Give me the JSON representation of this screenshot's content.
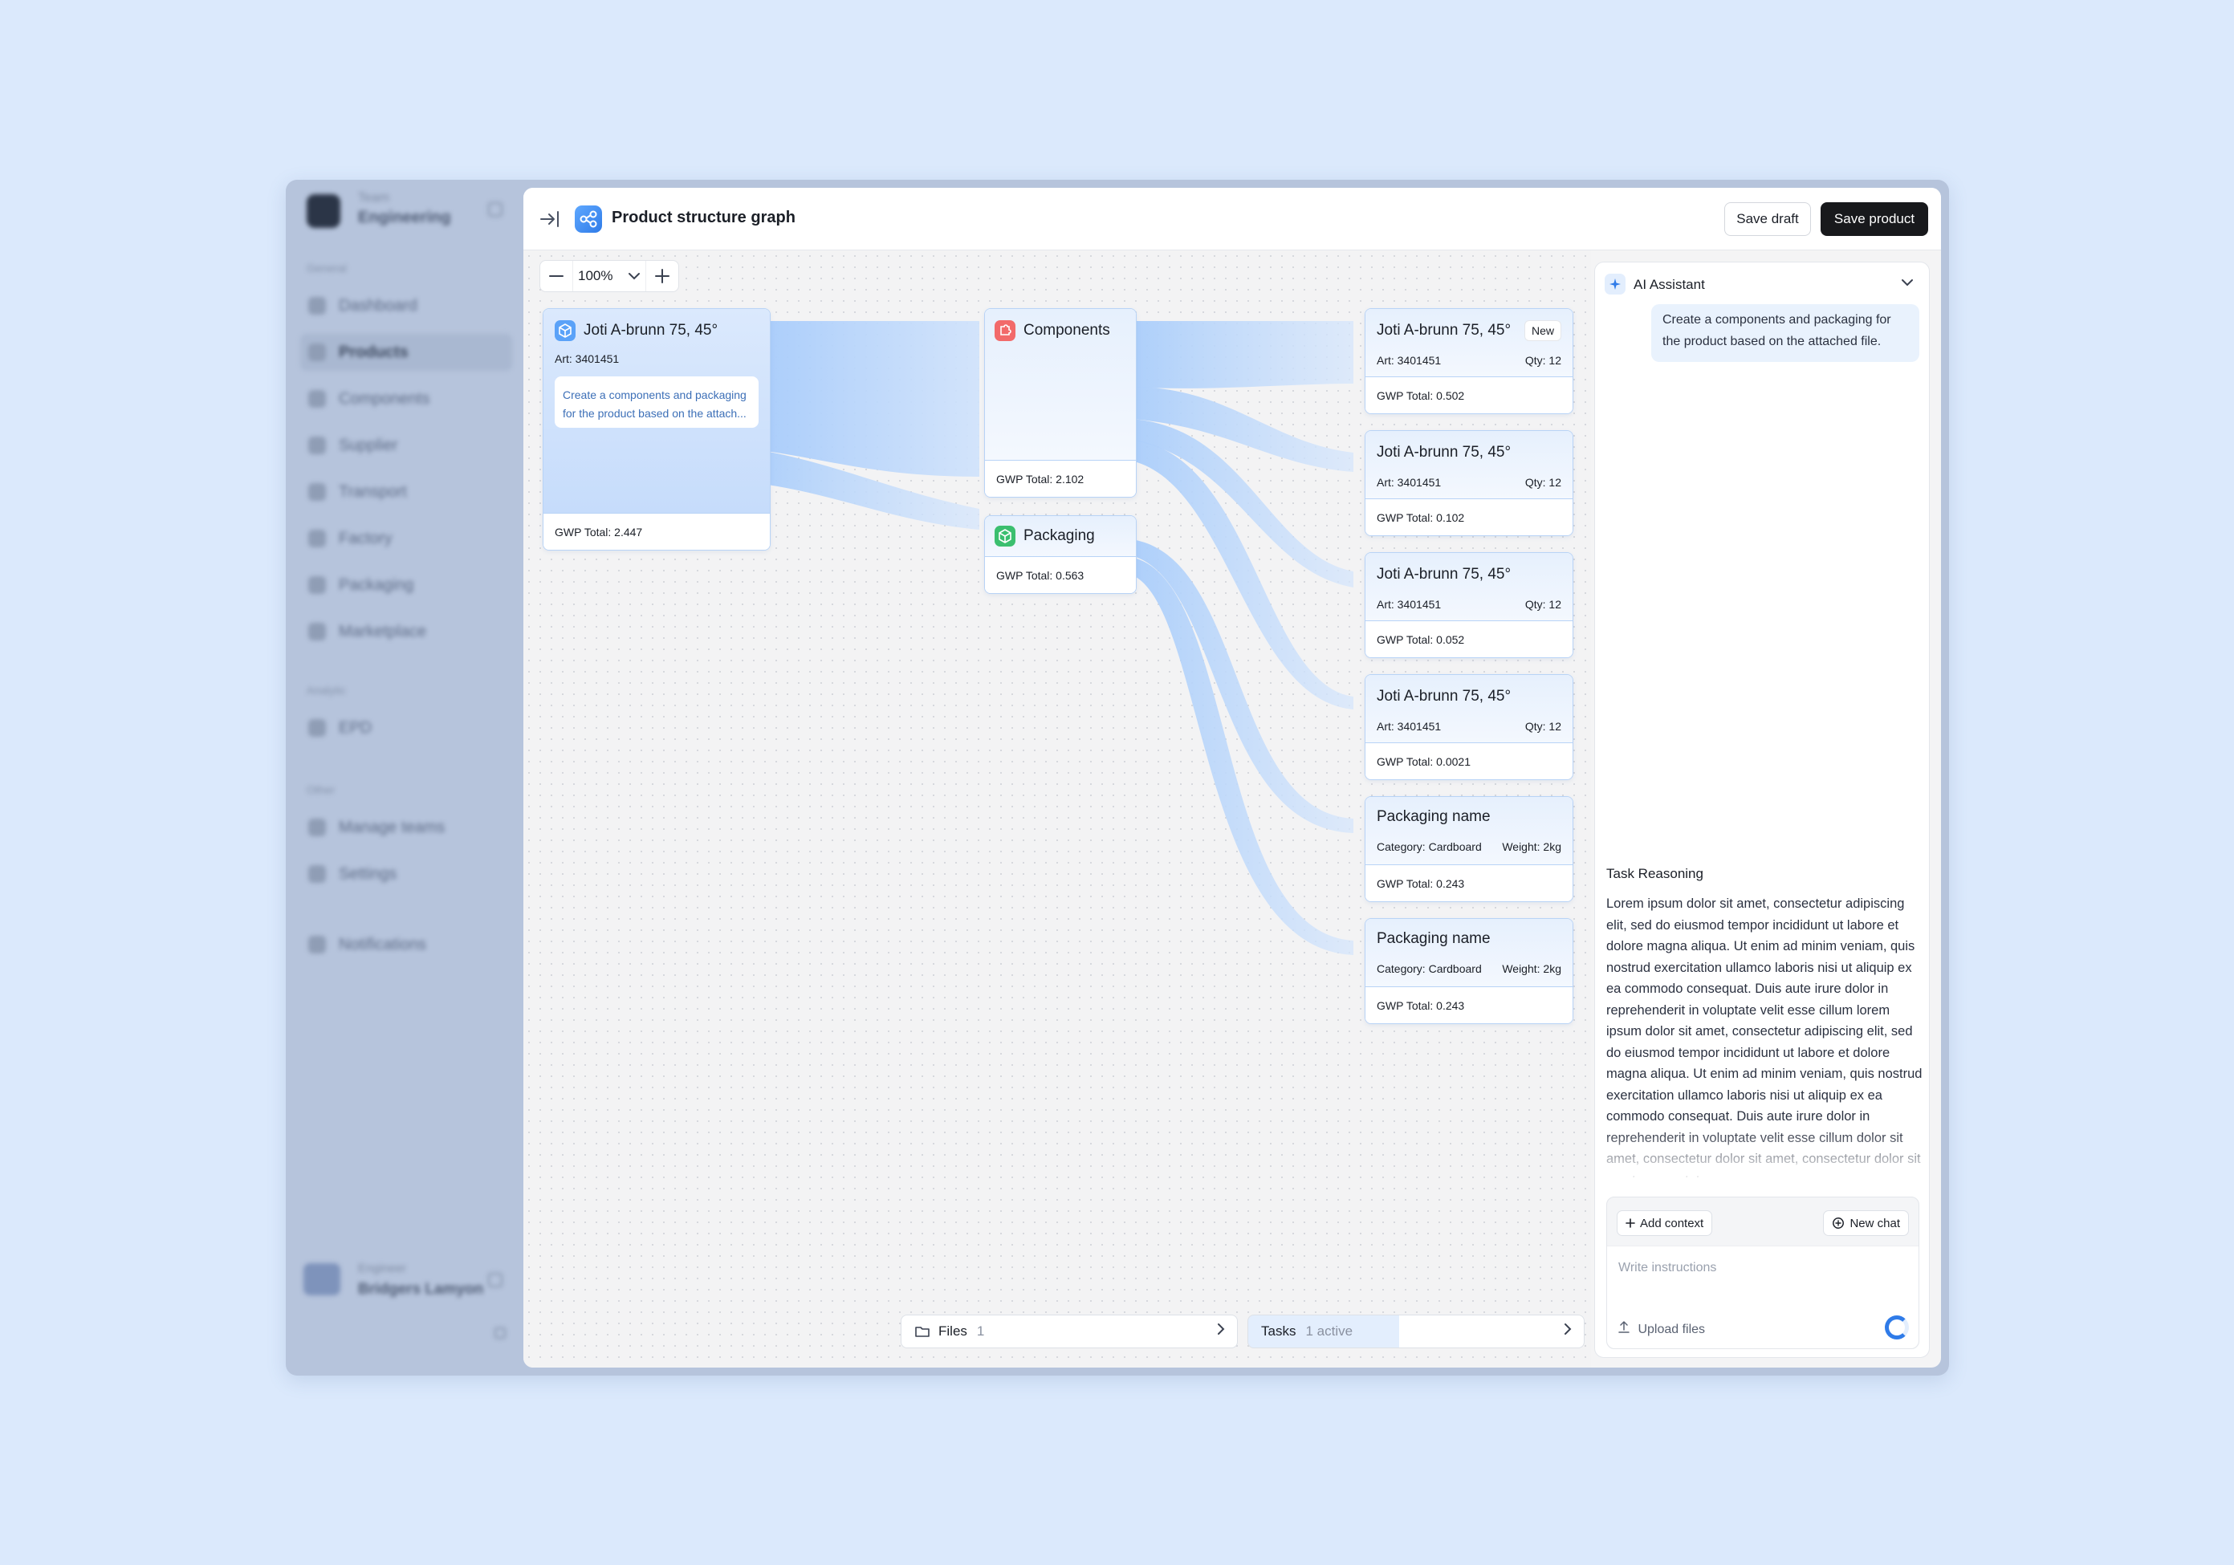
{
  "sidebar": {
    "team_label": "Team",
    "team_name": "Engineering",
    "section_general": "General",
    "items": [
      {
        "label": "Dashboard"
      },
      {
        "label": "Products"
      },
      {
        "label": "Components"
      },
      {
        "label": "Supplier"
      },
      {
        "label": "Transport"
      },
      {
        "label": "Factory"
      },
      {
        "label": "Packaging"
      },
      {
        "label": "Marketplace"
      }
    ],
    "section_analytic": "Analytic",
    "analytic_items": [
      {
        "label": "EPD"
      }
    ],
    "section_other": "Other",
    "other_items": [
      {
        "label": "Manage teams"
      },
      {
        "label": "Settings"
      },
      {
        "label": "Notifications"
      }
    ],
    "user_role": "Engineer",
    "user_name": "Bridgers Lamyon"
  },
  "header": {
    "title": "Product structure graph",
    "save_draft": "Save draft",
    "save_product": "Save product"
  },
  "zoom": {
    "value": "100%"
  },
  "graph": {
    "root": {
      "title": "Joti A-brunn 75, 45°",
      "art": "Art: 3401451",
      "message": "Create a components and packaging for the product based on the attach...",
      "gwp": "GWP Total: 2.447"
    },
    "components": {
      "title": "Components",
      "gwp": "GWP Total: 2.102"
    },
    "packaging": {
      "title": "Packaging",
      "gwp": "GWP Total: 0.563"
    },
    "leaves": [
      {
        "title": "Joti A-brunn 75, 45°",
        "badge": "New",
        "left": "Art: 3401451",
        "right": "Qty: 12",
        "gwp": "GWP Total: 0.502"
      },
      {
        "title": "Joti A-brunn 75, 45°",
        "left": "Art: 3401451",
        "right": "Qty: 12",
        "gwp": "GWP Total: 0.102"
      },
      {
        "title": "Joti A-brunn 75, 45°",
        "left": "Art: 3401451",
        "right": "Qty: 12",
        "gwp": "GWP Total: 0.052"
      },
      {
        "title": "Joti A-brunn 75, 45°",
        "left": "Art: 3401451",
        "right": "Qty: 12",
        "gwp": "GWP Total: 0.0021"
      },
      {
        "title": "Packaging name",
        "left": "Category: Cardboard",
        "right": "Weight: 2kg",
        "gwp": "GWP Total: 0.243"
      },
      {
        "title": "Packaging name",
        "left": "Category: Cardboard",
        "right": "Weight: 2kg",
        "gwp": "GWP Total: 0.243"
      }
    ]
  },
  "bottom": {
    "files_label": "Files",
    "files_count": "1",
    "tasks_label": "Tasks",
    "tasks_status": "1 active"
  },
  "ai": {
    "title": "AI Assistant",
    "user_message": "Create a components and packaging for the product based on the attached file.",
    "reasoning_title": "Task Reasoning",
    "reasoning_text": "Lorem ipsum dolor sit amet, consectetur adipiscing elit, sed do eiusmod tempor incididunt ut labore et dolore magna aliqua. Ut enim ad minim veniam, quis nostrud exercitation ullamco laboris nisi ut aliquip ex ea commodo consequat. Duis aute irure dolor in reprehenderit in voluptate velit esse cillum lorem ipsum dolor sit amet, consectetur adipiscing elit, sed do eiusmod tempor incididunt ut labore et dolore magna aliqua. Ut enim ad minim veniam, quis nostrud exercitation ullamco laboris nisi ut aliquip ex ea commodo consequat. Duis aute irure dolor in reprehenderit in voluptate velit esse cillum dolor sit amet, consectetur dolor sit amet, consectetur dolor sit amet, consectetur...",
    "add_context": "Add context",
    "new_chat": "New chat",
    "input_placeholder": "Write instructions",
    "upload_files": "Upload files"
  },
  "colors": {
    "accent": "#2f7be8",
    "flow": "#b9d5fb",
    "background": "#dbe9fc",
    "primary_button": "#18191c"
  }
}
